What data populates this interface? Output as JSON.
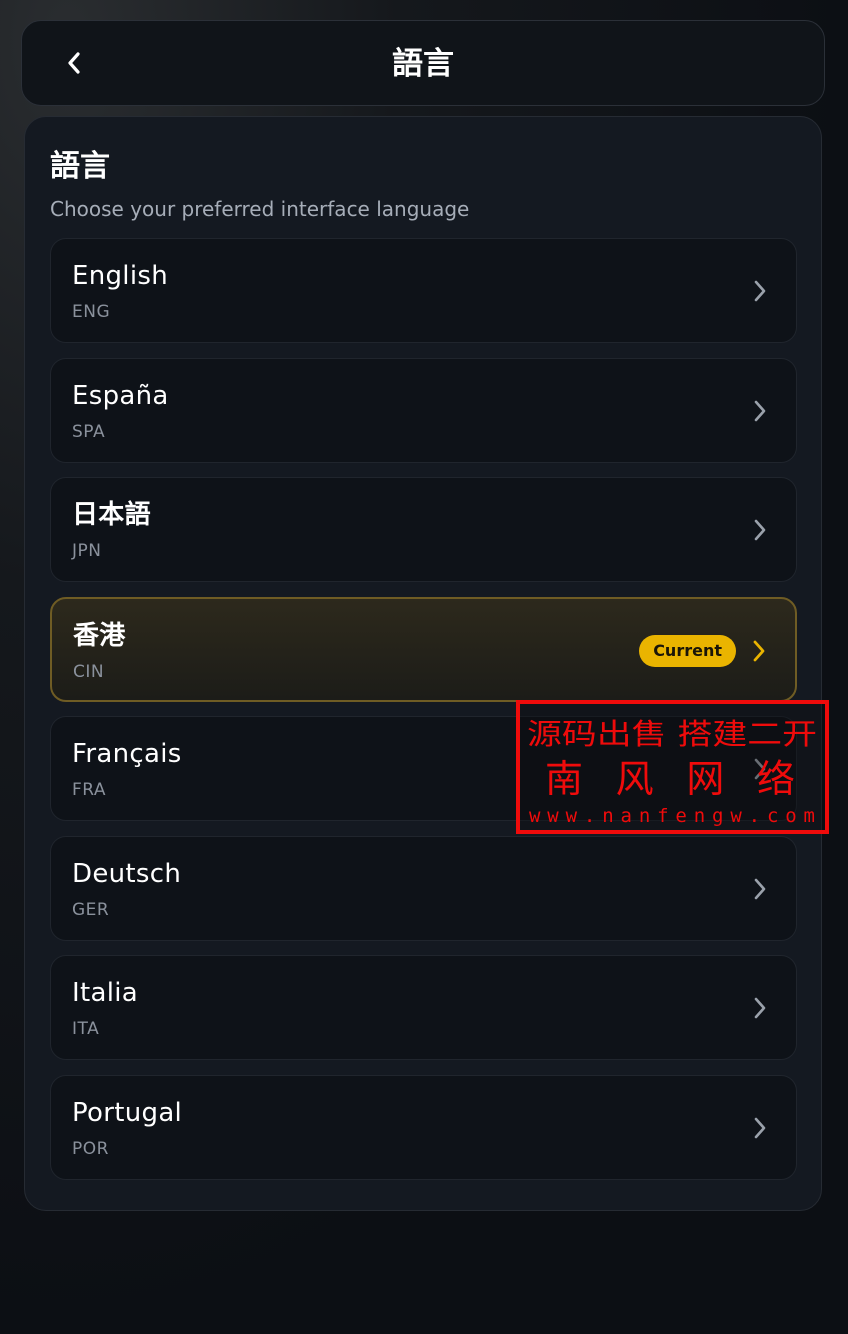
{
  "header": {
    "title": "語言",
    "back_icon": "chevron-left-icon"
  },
  "section": {
    "title": "語言",
    "subtitle": "Choose your preferred interface language"
  },
  "languages": [
    {
      "name": "English",
      "code": "ENG",
      "current": false
    },
    {
      "name": "España",
      "code": "SPA",
      "current": false
    },
    {
      "name": "日本語",
      "code": "JPN",
      "current": false
    },
    {
      "name": "香港",
      "code": "CIN",
      "current": true
    },
    {
      "name": "Français",
      "code": "FRA",
      "current": false
    },
    {
      "name": "Deutsch",
      "code": "GER",
      "current": false
    },
    {
      "name": "Italia",
      "code": "ITA",
      "current": false
    },
    {
      "name": "Portugal",
      "code": "POR",
      "current": false
    }
  ],
  "current_badge": "Current",
  "watermark": {
    "line1": "源码出售 搭建二开",
    "line2": "南 风 网 络",
    "line3": "www.nanfengw.com"
  },
  "colors": {
    "accent": "#eab400",
    "background": "#0c0f14",
    "card": "#0e1218",
    "chevron": "#9aa1ab",
    "watermark_red": "#ef0b0b"
  }
}
